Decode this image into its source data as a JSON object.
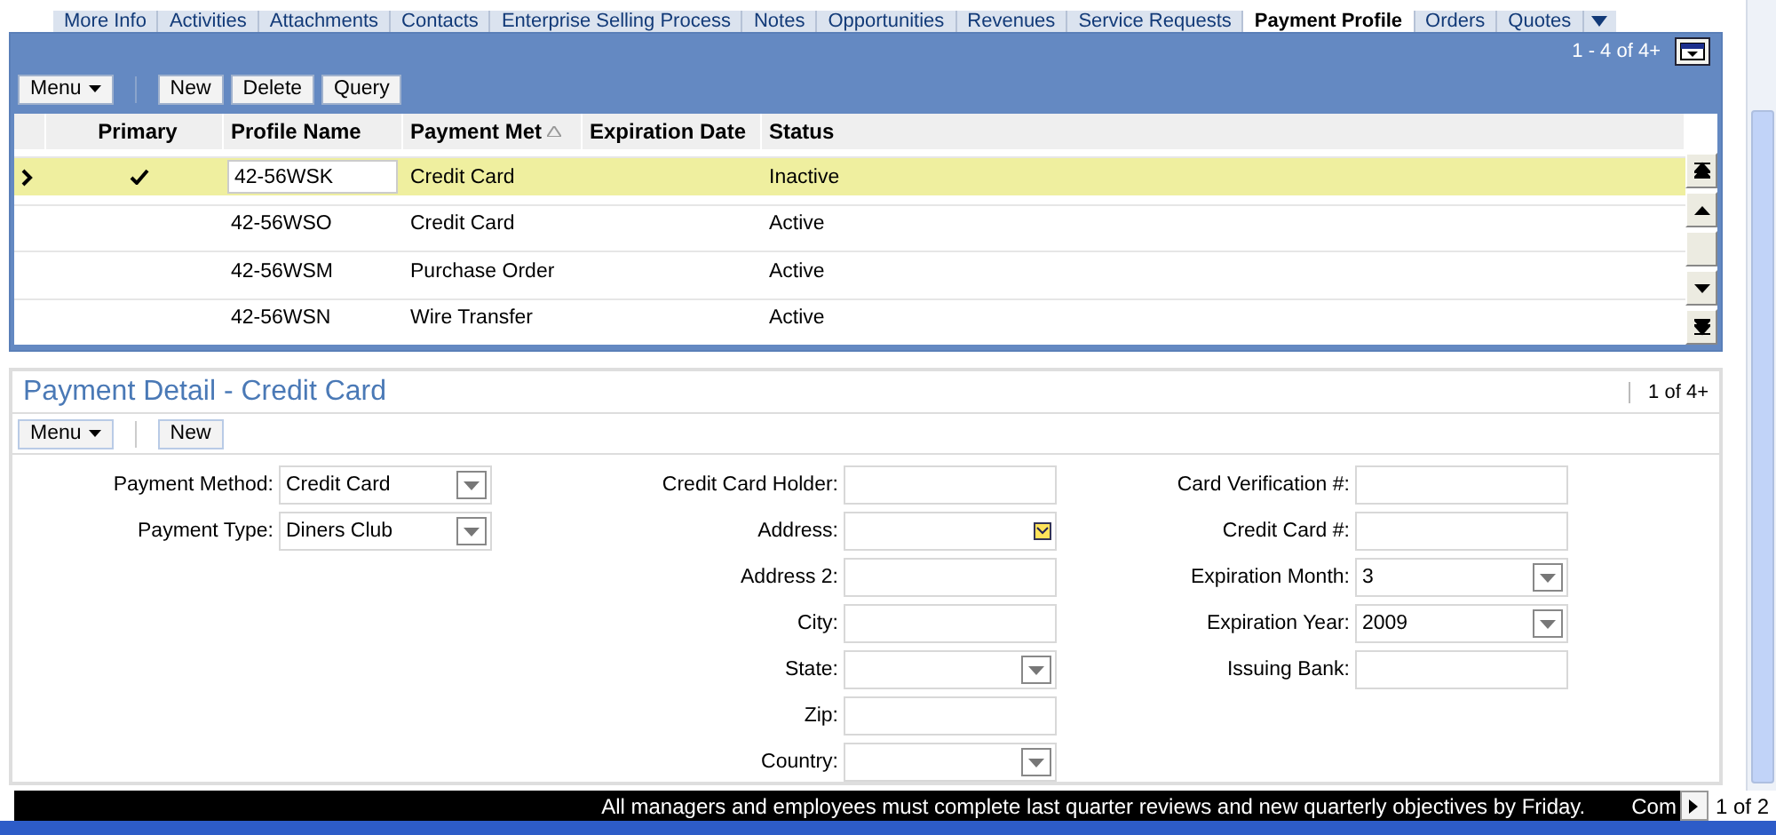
{
  "tabs": [
    {
      "label": "More Info",
      "selected": false
    },
    {
      "label": "Activities",
      "selected": false
    },
    {
      "label": "Attachments",
      "selected": false
    },
    {
      "label": "Contacts",
      "selected": false
    },
    {
      "label": "Enterprise Selling Process",
      "selected": false
    },
    {
      "label": "Notes",
      "selected": false
    },
    {
      "label": "Opportunities",
      "selected": false
    },
    {
      "label": "Revenues",
      "selected": false
    },
    {
      "label": "Service Requests",
      "selected": false
    },
    {
      "label": "Payment Profile",
      "selected": true
    },
    {
      "label": "Orders",
      "selected": false
    },
    {
      "label": "Quotes",
      "selected": false
    }
  ],
  "list_applet": {
    "record_count": "1 - 4 of 4+",
    "toolbar": [
      {
        "label": "Menu",
        "kind": "menu"
      },
      {
        "label": "New",
        "kind": "button"
      },
      {
        "label": "Delete",
        "kind": "button"
      },
      {
        "label": "Query",
        "kind": "button"
      }
    ],
    "columns": [
      "Primary",
      "Profile Name",
      "Payment Met",
      "Expiration Date",
      "Status"
    ],
    "rows": [
      {
        "selected": true,
        "primary": true,
        "profile_name": "42-56WSK",
        "payment_method": "Credit Card",
        "status": "Inactive"
      },
      {
        "selected": false,
        "primary": false,
        "profile_name": "42-56WSO",
        "payment_method": "Credit Card",
        "status": "Active"
      },
      {
        "selected": false,
        "primary": false,
        "profile_name": "42-56WSM",
        "payment_method": "Purchase Order",
        "status": "Active"
      },
      {
        "selected": false,
        "primary": false,
        "profile_name": "42-56WSN",
        "payment_method": "Wire Transfer",
        "status": "Active"
      }
    ]
  },
  "detail_applet": {
    "title": "Payment Detail - Credit Card",
    "record_count": "1 of 4+",
    "toolbar": [
      {
        "label": "Menu",
        "kind": "menu"
      },
      {
        "label": "New",
        "kind": "button"
      }
    ],
    "field_columns": [
      [
        {
          "label": "Payment Method:",
          "kind": "select",
          "value": "Credit Card"
        },
        {
          "label": "Payment Type:",
          "kind": "select",
          "value": "Diners Club"
        }
      ],
      [
        {
          "label": "Credit Card Holder:",
          "kind": "text"
        },
        {
          "label": "Address:",
          "kind": "lookup"
        },
        {
          "label": "Address 2:",
          "kind": "text"
        },
        {
          "label": "City:",
          "kind": "text"
        },
        {
          "label": "State:",
          "kind": "select"
        },
        {
          "label": "Zip:",
          "kind": "text"
        },
        {
          "label": "Country:",
          "kind": "select"
        }
      ],
      [
        {
          "label": "Card Verification #:",
          "kind": "text"
        },
        {
          "label": "Credit Card #:",
          "kind": "text"
        },
        {
          "label": "Expiration Month:",
          "kind": "select",
          "value": "3"
        },
        {
          "label": "Expiration Year:",
          "kind": "select",
          "value": "2009"
        },
        {
          "label": "Issuing Bank:",
          "kind": "text"
        }
      ]
    ]
  },
  "status_bar": {
    "message": "All managers and employees must complete last quarter reviews and new quarterly objectives by Friday.",
    "next_message": "Com",
    "page": "1 of 2"
  }
}
